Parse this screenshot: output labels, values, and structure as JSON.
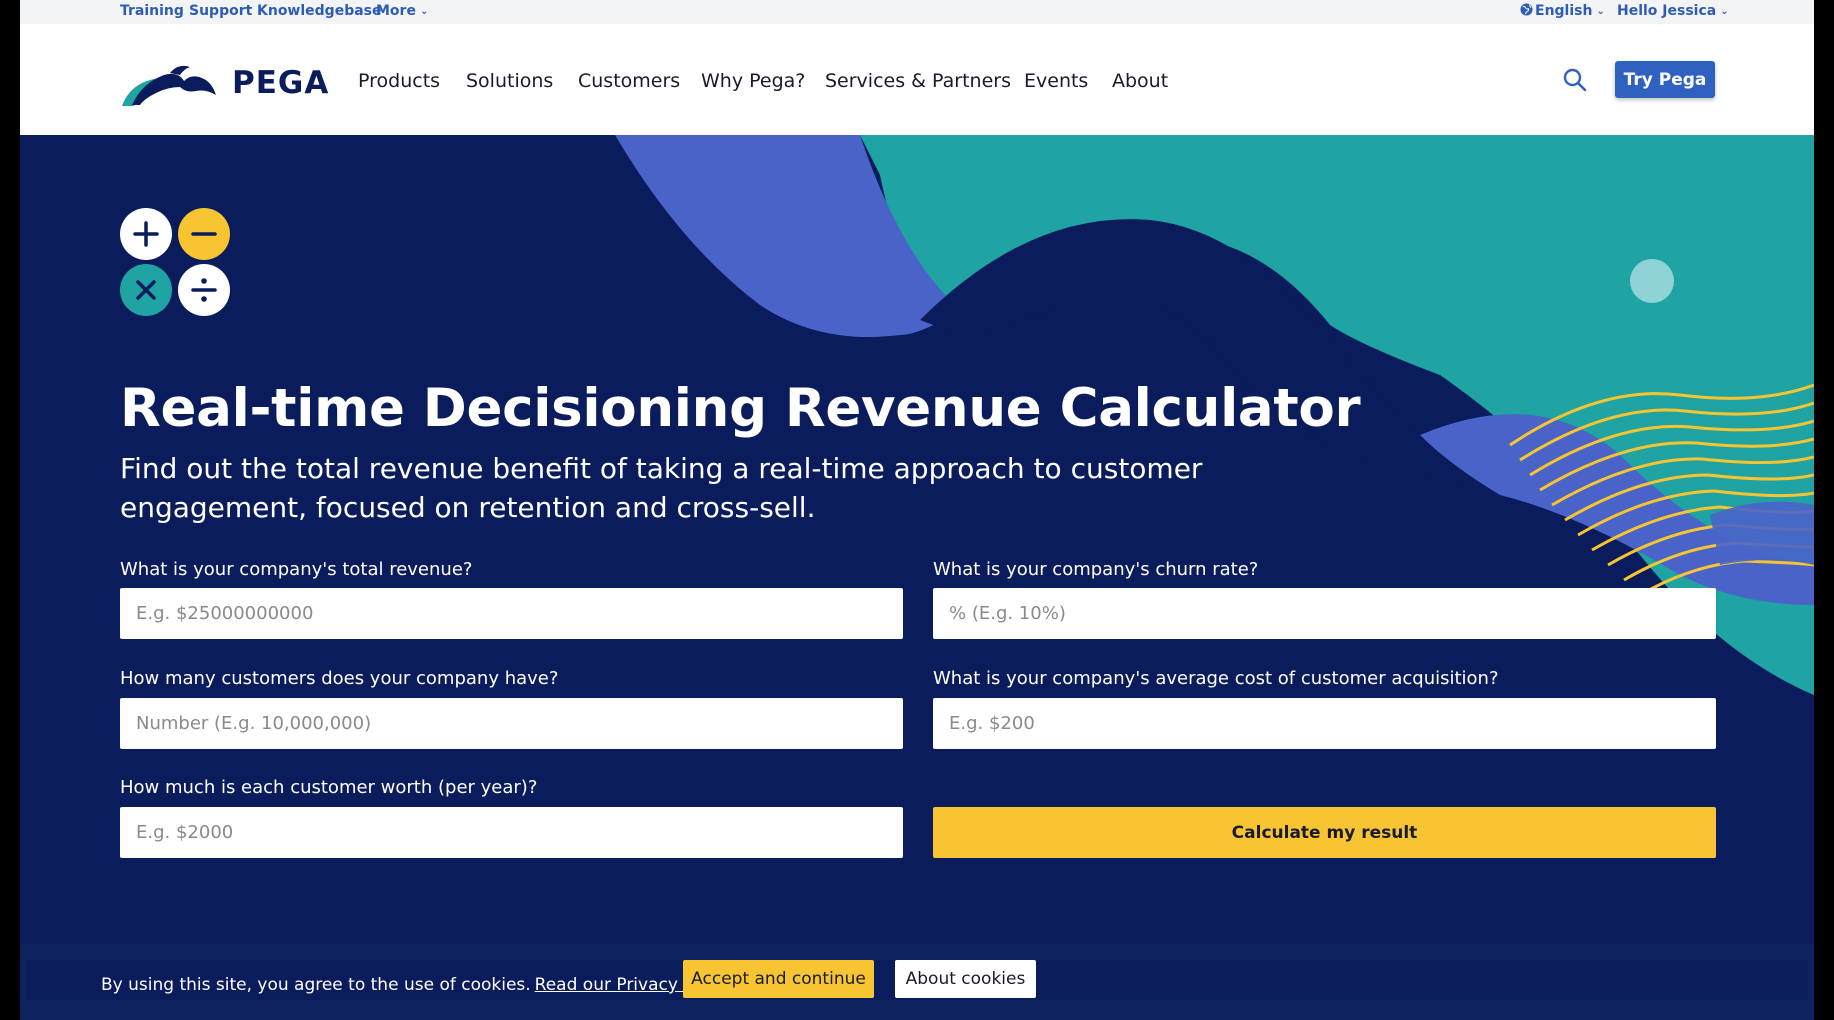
{
  "utility_bar": {
    "links": [
      "Training",
      "Support",
      "Knowledgebase"
    ],
    "more_label": "More",
    "language_label": "English",
    "user_label": "Hello Jessica"
  },
  "nav": {
    "logo_text": "PEGA",
    "items": [
      "Products",
      "Solutions",
      "Customers",
      "Why Pega?",
      "Services & Partners",
      "Events",
      "About"
    ],
    "try_button": "Try Pega"
  },
  "hero": {
    "title": "Real-time Decisioning Revenue Calculator",
    "subtitle": "Find out the total revenue benefit of taking a real-time approach to customer engagement, focused on retention and cross-sell.",
    "icons": [
      "plus-icon",
      "minus-icon",
      "times-icon",
      "divide-icon"
    ]
  },
  "form": {
    "revenue": {
      "label": "What is your company's total revenue?",
      "placeholder": "E.g. $25000000000",
      "value": ""
    },
    "churn": {
      "label": "What is your company's churn rate?",
      "placeholder": "% (E.g. 10%)",
      "value": ""
    },
    "customers": {
      "label": "How many customers does your company have?",
      "placeholder": "Number (E.g. 10,000,000)",
      "value": ""
    },
    "acquisition": {
      "label": "What is your company's average cost of customer acquisition?",
      "placeholder": "E.g. $200",
      "value": ""
    },
    "worth": {
      "label": "How much is each customer worth (per year)?",
      "placeholder": "E.g. $2000",
      "value": ""
    },
    "calculate_button": "Calculate my result"
  },
  "cookie_banner": {
    "text": "By using this site, you agree to the use of cookies.",
    "privacy_link": "Read our Privacy Policy",
    "accept_button": "Accept and continue",
    "about_button": "About cookies"
  },
  "colors": {
    "navy": "#0b1c5c",
    "teal": "#1fa3a3",
    "periwinkle": "#4a63c9",
    "yellow": "#f7c531",
    "link_blue": "#2e5bb5",
    "button_blue": "#2f62c0"
  }
}
